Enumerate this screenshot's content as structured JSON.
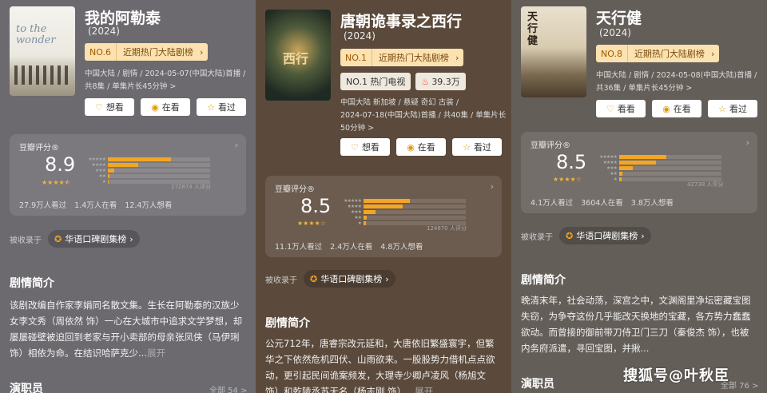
{
  "panels": [
    {
      "title": "我的阿勒泰",
      "year": "(2024)",
      "rank": {
        "no": "NO.6",
        "label": "近期热门大陆剧榜"
      },
      "meta": [
        "中国大陆 / 剧情 / 2024-05-07(中国大陆)首播 /",
        "共8集 / 单集片长45分钟 >"
      ],
      "buttons": {
        "want": "想看",
        "watching": "在看",
        "watched": "看过"
      },
      "rating": {
        "label": "豆瓣评分®",
        "score": "8.9",
        "dist": [
          0.62,
          0.3,
          0.06,
          0.015,
          0.01
        ],
        "count": "272874 人评分",
        "stats": [
          "27.9万人看过",
          "1.4万人在看",
          "12.4万人想看"
        ],
        "stars": 4.5
      },
      "collection": {
        "prefix": "被收录于",
        "chip": "华语口碑剧集榜"
      },
      "plot_heading": "剧情简介",
      "plot": "该剧改编自作家李娟同名散文集。生长在阿勒泰的汉族少女李文秀（周依然 饰）一心在大城市中追求文学梦想，却屡屡碰壁被迫回到老家与开小卖部的母亲张凤侠（马伊琍 饰）相依为命。在结识哈萨克少...",
      "more": "展开",
      "cast_heading": "演职员",
      "cast_all": "全部 54 >"
    },
    {
      "title": "唐朝诡事录之西行",
      "year": "(2024)",
      "rank": {
        "no": "NO.1",
        "label": "近期热门大陆剧榜"
      },
      "tags": [
        {
          "label": "NO.1 热门电视"
        },
        {
          "label": "39.3万"
        }
      ],
      "meta": [
        "中国大陆 新加坡 / 悬疑 奇幻 古装 /",
        "2024-07-18(中国大陆)首播 / 共40集 / 单集片长",
        "50分钟 >"
      ],
      "buttons": {
        "want": "想看",
        "watching": "在看",
        "watched": "看过"
      },
      "rating": {
        "label": "豆瓣评分®",
        "score": "8.5",
        "dist": [
          0.45,
          0.38,
          0.12,
          0.03,
          0.02
        ],
        "count": "124870 人评分",
        "stats": [
          "11.1万人看过",
          "2.4万人在看",
          "4.8万人想看"
        ],
        "stars": 4
      },
      "collection": {
        "prefix": "被收录于",
        "chip": "华语口碑剧集榜"
      },
      "plot_heading": "剧情简介",
      "plot": "公元712年，唐睿宗改元延和，大唐依旧繁盛寰宇，但繁华之下依然危机四伏、山雨欲来。一股股势力借机点点欲动，更引起民间诡案频发，大理寺少卿卢凌风（杨旭文 饰）和乾陵丞苏无名（杨志刚 饰）...",
      "more": "展开"
    },
    {
      "title": "天行健",
      "year": "(2024)",
      "rank": {
        "no": "NO.8",
        "label": "近期热门大陆剧榜"
      },
      "meta": [
        "中国大陆 / 剧情 / 2024-05-08(中国大陆)首播 /",
        "共36集 / 单集片长45分钟 >"
      ],
      "buttons": {
        "want": "看看",
        "watching": "在看",
        "watched": "看过"
      },
      "rating": {
        "label": "豆瓣评分®",
        "score": "8.5",
        "dist": [
          0.46,
          0.36,
          0.13,
          0.03,
          0.02
        ],
        "count": "42738 人评分",
        "stats": [
          "4.1万人看过",
          "3604人在看",
          "3.8万人想看"
        ],
        "stars": 4
      },
      "collection": {
        "prefix": "被收录于",
        "chip": "华语口碑剧集榜"
      },
      "plot_heading": "剧情简介",
      "plot": "晚清末年，社会动荡，深宫之中，文渊阁里净坛密藏宝图失窃，为争夺这份几乎能改天换地的宝藏，各方势力蠢蠢欲动。而曾接的御前带刀侍卫门三刀（秦俊杰 饰），也被内务府派遣，寻回宝图，并揪...",
      "cast_heading": "演职员",
      "cast_all": "全部 76 >"
    }
  ],
  "watermark": "搜狐号@叶秋臣",
  "poster_texts": {
    "p0": "to the wonder",
    "p1": "西行",
    "p2": "天行健"
  }
}
